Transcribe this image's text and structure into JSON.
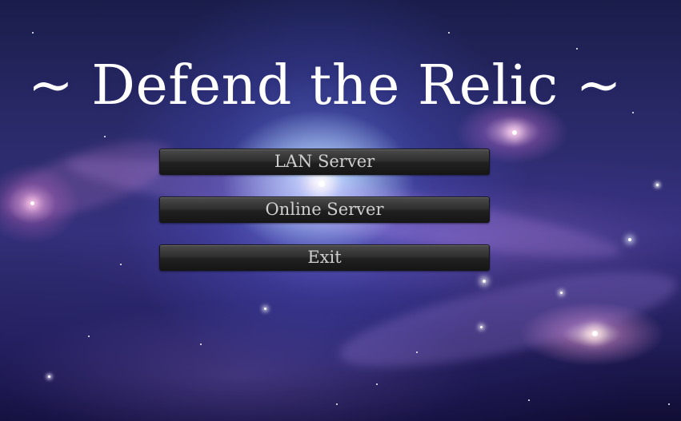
{
  "title": "~ Defend the Relic ~",
  "menu": {
    "items": [
      {
        "label": "LAN Server"
      },
      {
        "label": "Online Server"
      },
      {
        "label": "Exit"
      }
    ]
  },
  "colors": {
    "title_text": "#ffffff",
    "button_text": "#cfcfcf",
    "button_top": "#4a4a4a",
    "button_bottom": "#161616",
    "space_base": "#2a2a6a"
  }
}
